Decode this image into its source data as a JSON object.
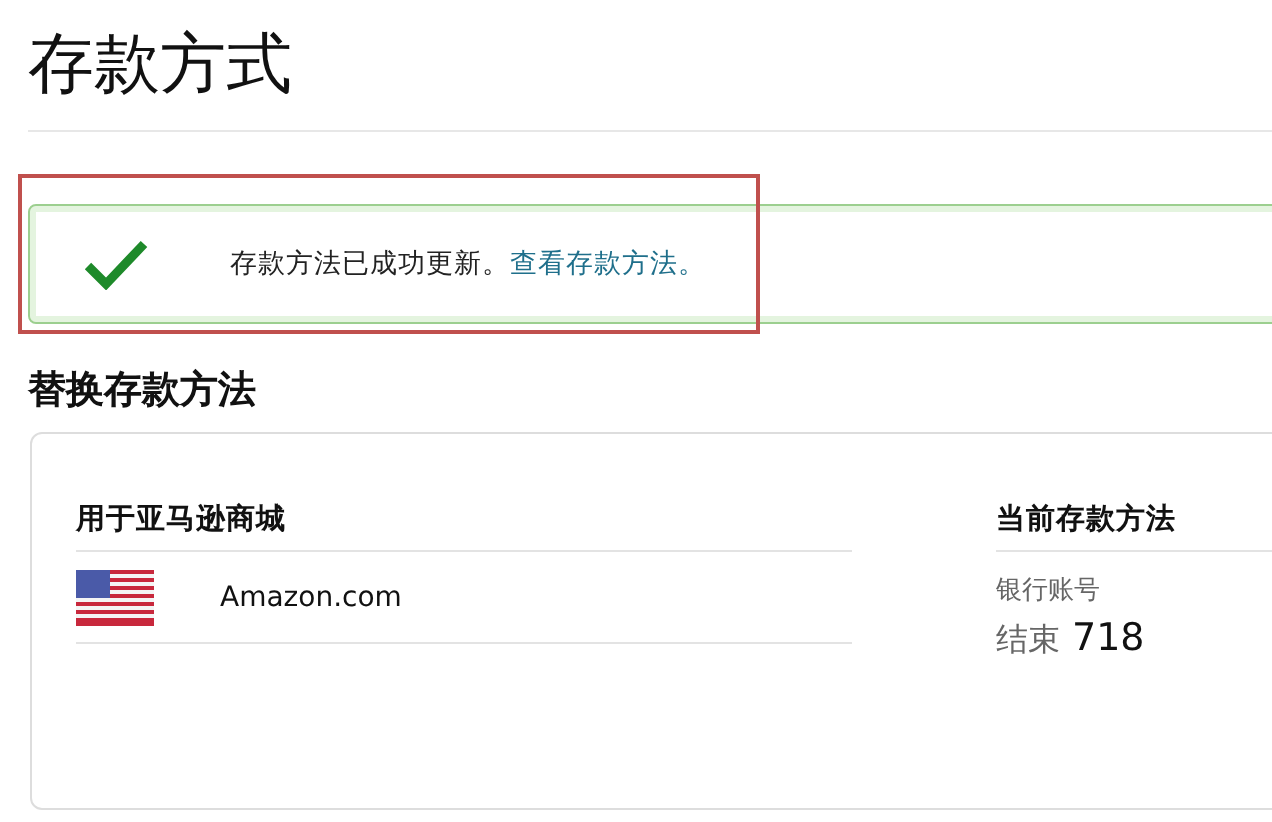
{
  "page_title": "存款方式",
  "alert": {
    "message": "存款方法已成功更新。",
    "link": "查看存款方法。"
  },
  "section_title": "替换存款方法",
  "card": {
    "marketplace_heading": "用于亚马逊商城",
    "marketplaces": [
      {
        "name": "Amazon.com"
      }
    ],
    "current_heading": "当前存款方法",
    "method_type": "银行账号",
    "ending_label": "结束",
    "ending_digits": "718"
  }
}
